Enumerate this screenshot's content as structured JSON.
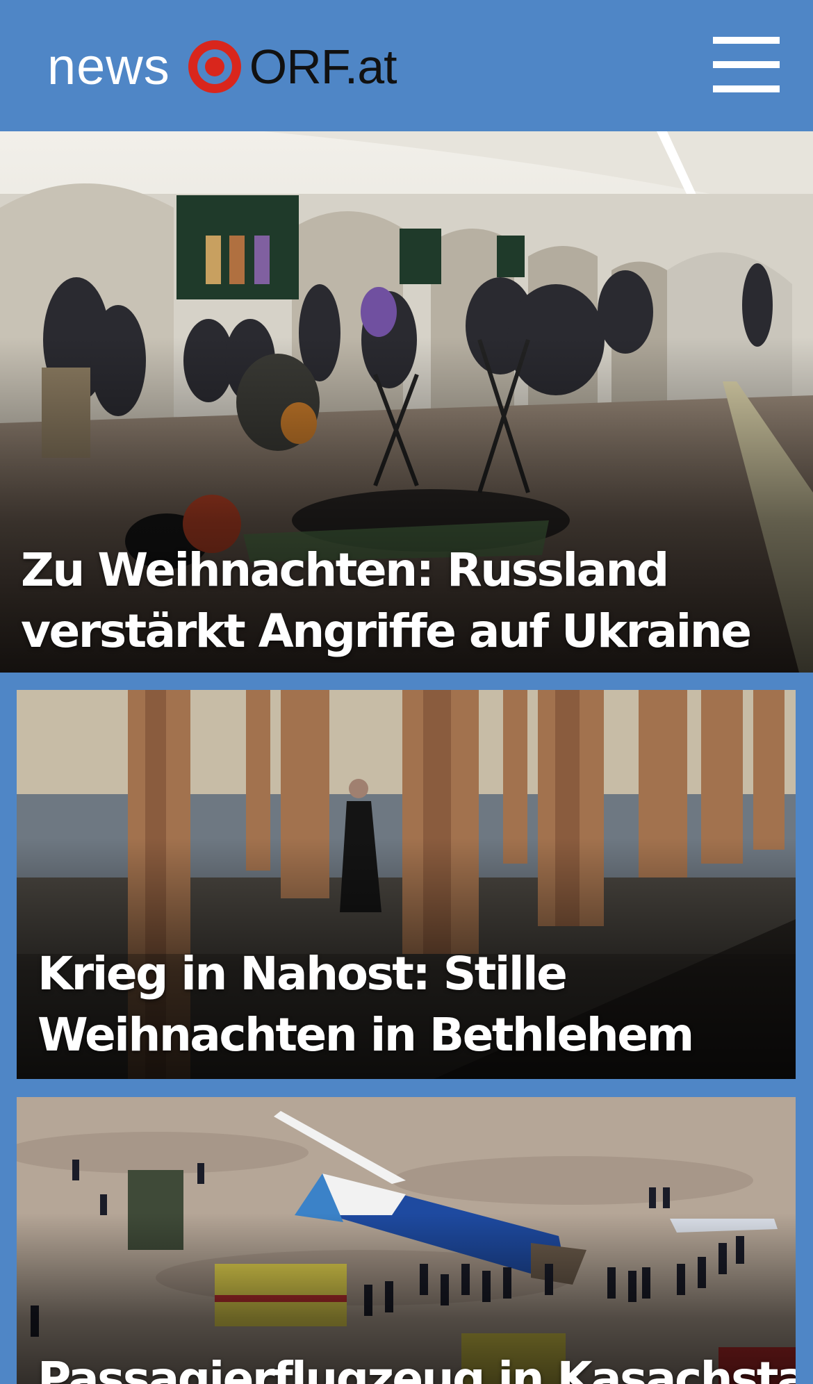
{
  "header": {
    "logo_news": "news",
    "logo_orf": "ORF.at",
    "menu_icon": "hamburger-menu-icon",
    "background_color": "#4f86c6"
  },
  "stories": [
    {
      "headline": "Zu Weihnachten: Russland verstärkt Angriffe auf Ukraine"
    },
    {
      "headline": "Krieg in Nahost: Stille Weihnachten in Bethlehem"
    },
    {
      "headline": "Passagierflugzeug in Kasachstan"
    }
  ],
  "colors": {
    "brand_blue": "#4f86c6",
    "orf_red": "#d9261c"
  }
}
